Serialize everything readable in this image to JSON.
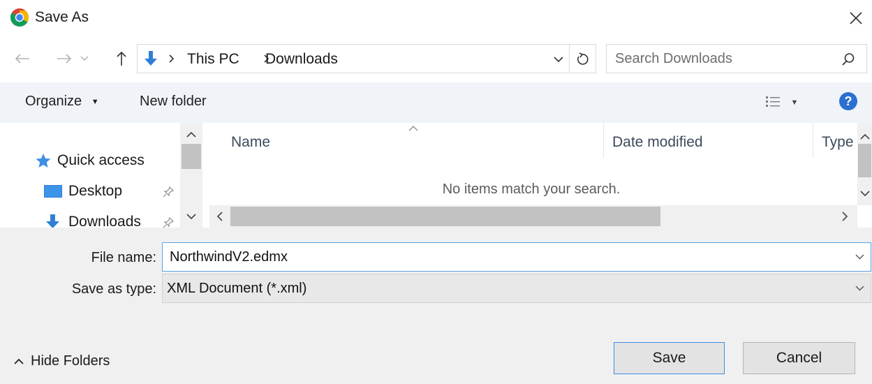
{
  "window": {
    "title": "Save As",
    "app_icon": "chrome-icon",
    "close_icon": "close-icon"
  },
  "navigation": {
    "back_icon": "back-arrow-icon",
    "forward_icon": "forward-arrow-icon",
    "recent_icon": "chevron-down-icon",
    "up_icon": "up-arrow-icon",
    "breadcrumb": [
      "This PC",
      "Downloads"
    ],
    "location_icon": "download-folder-icon",
    "refresh_icon": "refresh-icon"
  },
  "search": {
    "placeholder": "Search Downloads",
    "icon": "search-icon"
  },
  "toolbar": {
    "organize_label": "Organize",
    "new_folder_label": "New folder",
    "view_icon": "view-details-icon",
    "help_icon": "help-icon"
  },
  "nav_pane": {
    "items": [
      {
        "label": "Quick access",
        "icon": "star-icon"
      },
      {
        "label": "Desktop",
        "icon": "desktop-icon",
        "pinned": true
      },
      {
        "label": "Downloads",
        "icon": "download-icon",
        "pinned": true
      }
    ]
  },
  "file_list": {
    "columns": [
      "Name",
      "Date modified",
      "Type"
    ],
    "empty_message": "No items match your search."
  },
  "form": {
    "file_name_label": "File name:",
    "file_name_value": "NorthwindV2.edmx",
    "save_as_type_label": "Save as type:",
    "save_as_type_value": "XML Document (*.xml)"
  },
  "footer": {
    "hide_folders_label": "Hide Folders",
    "save_label": "Save",
    "cancel_label": "Cancel"
  },
  "colors": {
    "accent": "#3a8ee6",
    "toolbar_bg": "#f0f4f9",
    "panel_bg": "#f0f0f0",
    "help_blue": "#2b6fd1"
  }
}
